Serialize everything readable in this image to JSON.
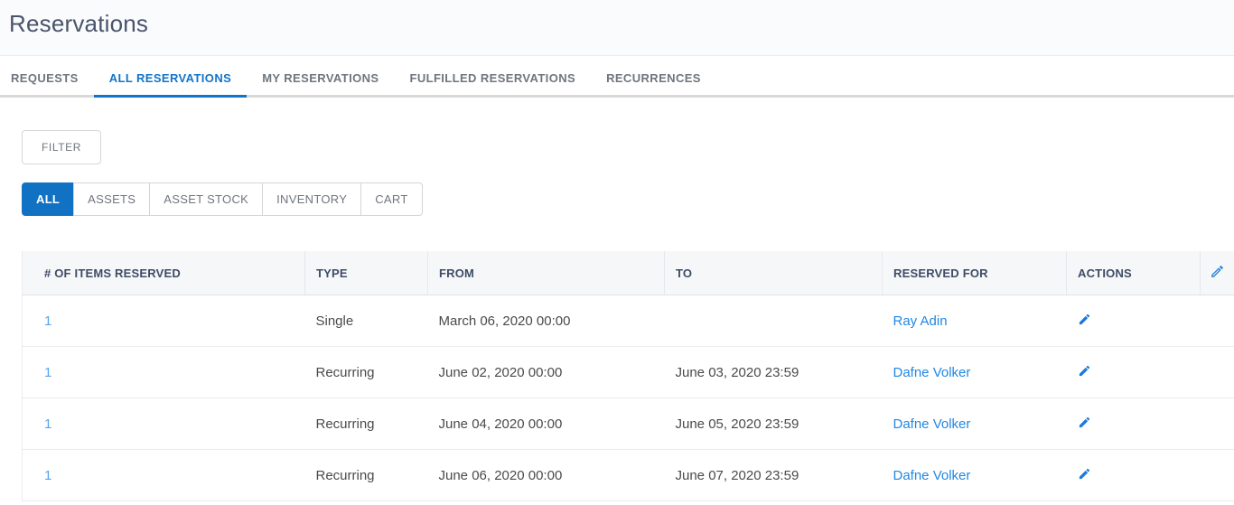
{
  "page": {
    "title": "Reservations"
  },
  "tabs": [
    {
      "label": "REQUESTS",
      "active": false
    },
    {
      "label": "ALL RESERVATIONS",
      "active": true
    },
    {
      "label": "MY RESERVATIONS",
      "active": false
    },
    {
      "label": "FULFILLED RESERVATIONS",
      "active": false
    },
    {
      "label": "RECURRENCES",
      "active": false
    }
  ],
  "toolbar": {
    "filter_label": "FILTER"
  },
  "type_filters": [
    {
      "label": "ALL",
      "active": true
    },
    {
      "label": "ASSETS",
      "active": false
    },
    {
      "label": "ASSET STOCK",
      "active": false
    },
    {
      "label": "INVENTORY",
      "active": false
    },
    {
      "label": "CART",
      "active": false
    }
  ],
  "table": {
    "columns": {
      "items": "# OF ITEMS RESERVED",
      "type": "TYPE",
      "from": "FROM",
      "to": "TO",
      "reserved_for": "RESERVED FOR",
      "actions": "ACTIONS"
    },
    "rows": [
      {
        "items": "1",
        "type": "Single",
        "from": "March 06, 2020 00:00",
        "to": "",
        "reserved_for": "Ray Adin"
      },
      {
        "items": "1",
        "type": "Recurring",
        "from": "June 02, 2020 00:00",
        "to": "June 03, 2020 23:59",
        "reserved_for": "Dafne Volker"
      },
      {
        "items": "1",
        "type": "Recurring",
        "from": "June 04, 2020 00:00",
        "to": "June 05, 2020 23:59",
        "reserved_for": "Dafne Volker"
      },
      {
        "items": "1",
        "type": "Recurring",
        "from": "June 06, 2020 00:00",
        "to": "June 07, 2020 23:59",
        "reserved_for": "Dafne Volker"
      }
    ]
  },
  "icons": {
    "row_action": "edit-pencil-icon",
    "header_action": "edit-columns-pencil-icon"
  },
  "colors": {
    "accent_blue": "#1172c3",
    "tab_active_blue": "#1274c9",
    "link_blue": "#2187e3",
    "count_link_blue": "#55a4ee",
    "pencil_blue": "#1b79dc",
    "header_bg": "#fafbfd",
    "table_header_bg": "#f6f7f9"
  }
}
